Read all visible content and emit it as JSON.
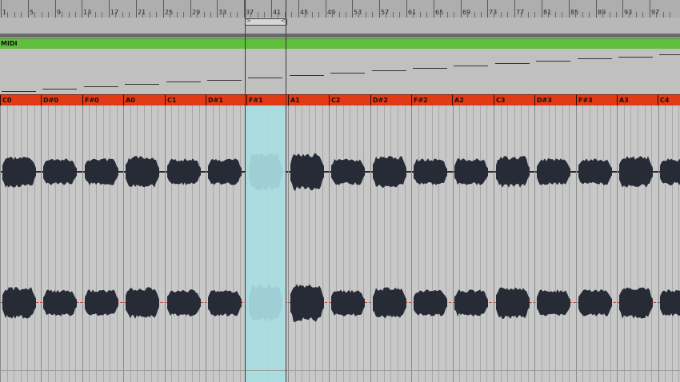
{
  "ruler": {
    "bar_numbers": [
      "1",
      "5",
      "9",
      "13",
      "17",
      "21",
      "25",
      "29",
      "33",
      "37",
      "41",
      "45",
      "49",
      "53",
      "57",
      "61",
      "65",
      "69",
      "73",
      "77",
      "81",
      "85",
      "89",
      "93",
      "97"
    ]
  },
  "clip": {
    "name": "MIDI",
    "color": "#5fbf3c"
  },
  "sample_names": [
    "C0",
    "D#0",
    "F#0",
    "A0",
    "C1",
    "D#1",
    "F#1",
    "A1",
    "C2",
    "D#2",
    "F#2",
    "A2",
    "C3",
    "D#3",
    "F#3",
    "A3",
    "C4"
  ],
  "colors": {
    "name_strip": "#e23a14",
    "selection": "#a8dde2",
    "waveform": "#262b36"
  },
  "selection": {
    "start_bar": "37",
    "end_bar": "41"
  }
}
